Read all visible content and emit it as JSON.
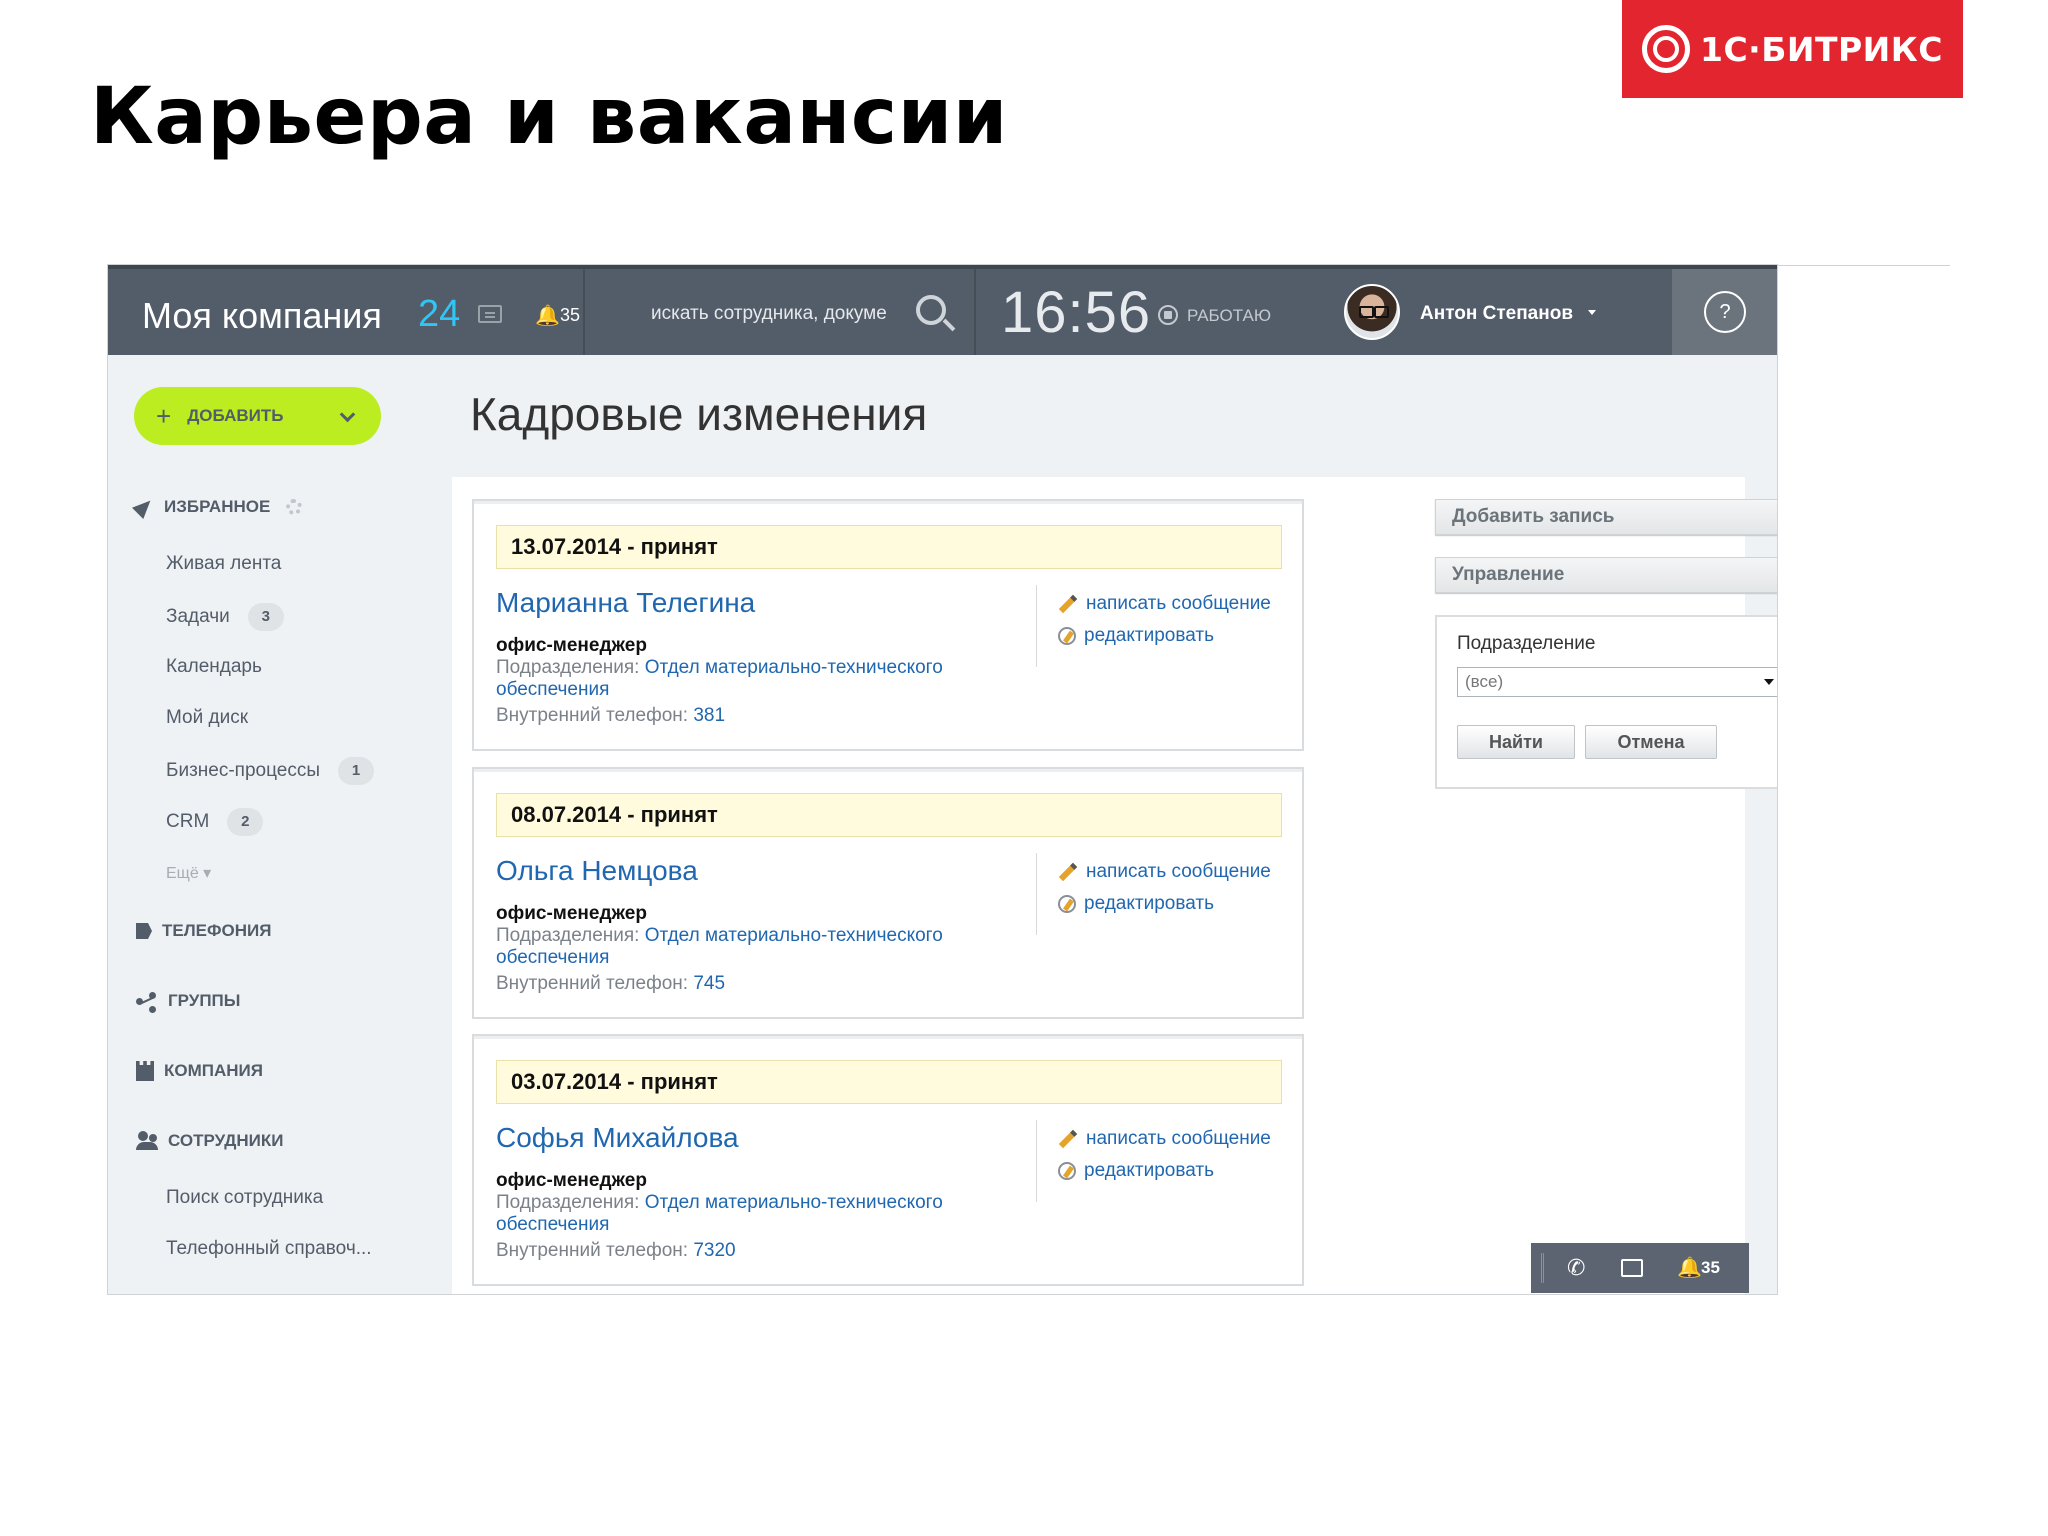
{
  "slide": {
    "title": "Карьера и вакансии",
    "brand": "1С·БИТРИКС"
  },
  "topbar": {
    "company": "Моя компания",
    "company_count": "24",
    "notifications": "35",
    "search_placeholder": "искать сотрудника, докуме",
    "clock": "16:56",
    "status": "РАБОТАЮ",
    "user_name": "Антон Степанов",
    "help": "?"
  },
  "sidebar": {
    "add_button": "ДОБАВИТЬ",
    "favorites": "ИЗБРАННОЕ",
    "items": [
      {
        "label": "Живая лента",
        "badge": ""
      },
      {
        "label": "Задачи",
        "badge": "3"
      },
      {
        "label": "Календарь",
        "badge": ""
      },
      {
        "label": "Мой диск",
        "badge": ""
      },
      {
        "label": "Бизнес-процессы",
        "badge": "1"
      },
      {
        "label": "CRM",
        "badge": "2"
      }
    ],
    "more": "Ещё ▾",
    "telephony": "ТЕЛЕФОНИЯ",
    "groups": "ГРУППЫ",
    "company": "КОМПАНИЯ",
    "employees": "СОТРУДНИКИ",
    "employee_items": [
      "Поиск сотрудника",
      "Телефонный справоч..."
    ]
  },
  "page": {
    "title": "Кадровые изменения"
  },
  "cards": [
    {
      "header": "13.07.2014 - принят",
      "name": "Марианна Телегина",
      "role": "офис-менеджер",
      "dept_label": "Подразделения:",
      "dept_value": "Отдел материально-технического обеспечения",
      "phone_label": "Внутренний телефон:",
      "phone_value": "381",
      "action_message": "написать сообщение",
      "action_edit": "редактировать"
    },
    {
      "header": "08.07.2014 - принят",
      "name": "Ольга Немцова",
      "role": "офис-менеджер",
      "dept_label": "Подразделения:",
      "dept_value": "Отдел материально-технического обеспечения",
      "phone_label": "Внутренний телефон:",
      "phone_value": "745",
      "action_message": "написать сообщение",
      "action_edit": "редактировать"
    },
    {
      "header": "03.07.2014 - принят",
      "name": "Софья Михайлова",
      "role": "офис-менеджер",
      "dept_label": "Подразделения:",
      "dept_value": "Отдел материально-технического обеспечения",
      "phone_label": "Внутренний телефон:",
      "phone_value": "7320",
      "action_message": "написать сообщение",
      "action_edit": "редактировать"
    }
  ],
  "right_panel": {
    "add_record": "Добавить запись",
    "manage": "Управление",
    "filter_label": "Подразделение",
    "filter_value": "(все)",
    "find": "Найти",
    "cancel": "Отмена"
  },
  "minibar": {
    "notifications": "35"
  },
  "colors": {
    "topbar": "#535c69",
    "accent_count": "#2fc6f6",
    "add_button": "#bbed21",
    "link": "#2067b0",
    "brand": "#e3252f"
  }
}
